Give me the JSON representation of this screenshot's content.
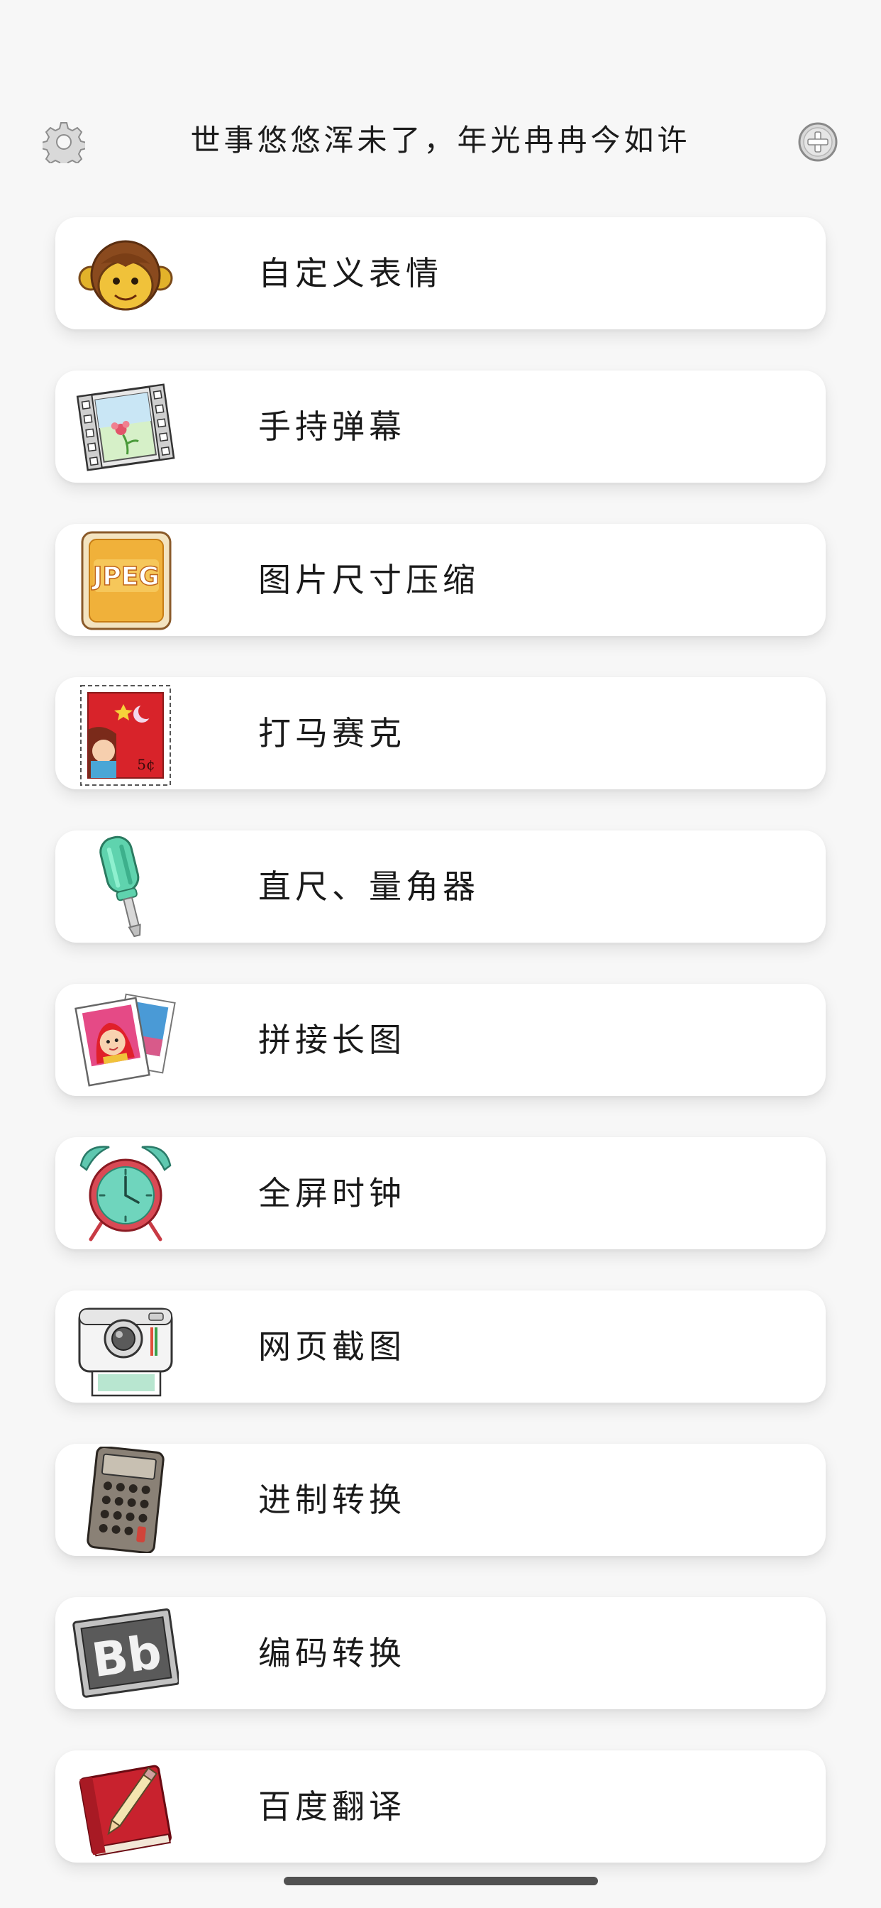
{
  "header": {
    "title": "世事悠悠浑未了，年光冉冉今如许",
    "settings_icon": "gear-icon",
    "add_icon": "plus-circle-icon"
  },
  "menu": {
    "items": [
      {
        "label": "自定义表情",
        "icon": "monkey-face-icon"
      },
      {
        "label": "手持弹幕",
        "icon": "film-strip-icon"
      },
      {
        "label": "图片尺寸压缩",
        "icon": "jpeg-icon"
      },
      {
        "label": "打马赛克",
        "icon": "stamp-icon"
      },
      {
        "label": "直尺、量角器",
        "icon": "screwdriver-icon"
      },
      {
        "label": "拼接长图",
        "icon": "photos-icon"
      },
      {
        "label": "全屏时钟",
        "icon": "alarm-clock-icon"
      },
      {
        "label": "网页截图",
        "icon": "instant-camera-icon"
      },
      {
        "label": "进制转换",
        "icon": "calculator-icon"
      },
      {
        "label": "编码转换",
        "icon": "chalkboard-bb-icon"
      },
      {
        "label": "百度翻译",
        "icon": "red-book-pencil-icon"
      }
    ]
  },
  "colors": {
    "background": "#f7f7f7",
    "card": "#ffffff",
    "text": "#1a1a1a"
  }
}
